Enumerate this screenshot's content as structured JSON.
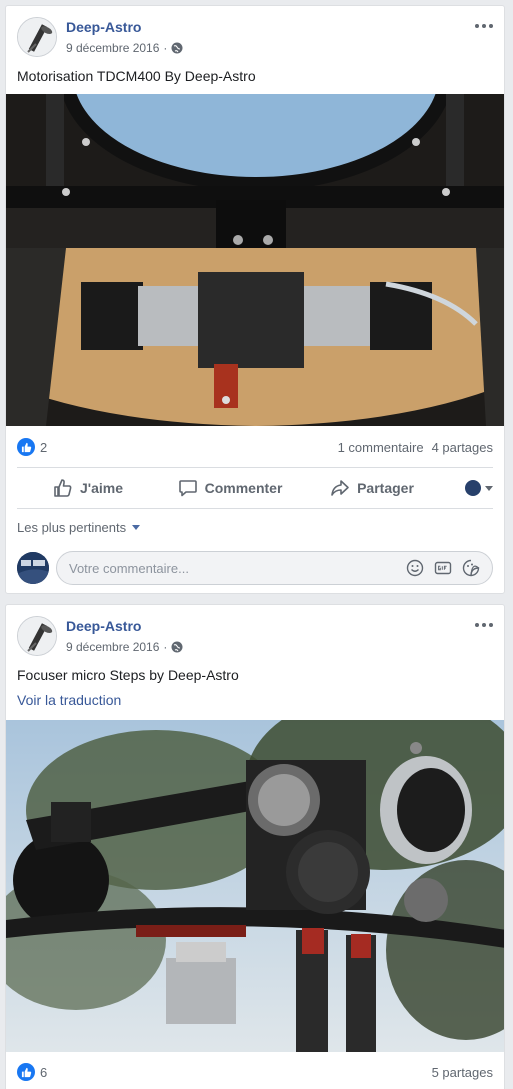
{
  "posts": [
    {
      "author": "Deep-Astro",
      "date": "9 décembre 2016",
      "caption": "Motorisation TDCM400 By Deep-Astro",
      "likes": "2",
      "comments": "1 commentaire",
      "shares": "4 partages",
      "actions": {
        "like": "J'aime",
        "comment": "Commenter",
        "share": "Partager"
      },
      "sort_label": "Les plus pertinents",
      "comment_placeholder": "Votre commentaire..."
    },
    {
      "author": "Deep-Astro",
      "date": "9 décembre 2016",
      "caption": "Focuser micro Steps by Deep-Astro",
      "translate_link": "Voir la traduction",
      "likes": "6",
      "shares": "5 partages"
    }
  ],
  "icons": {
    "globe": "globe-icon",
    "more": "more-options-icon",
    "like": "thumbs-up-icon",
    "comment": "speech-bubble-icon",
    "share": "share-arrow-icon",
    "emoji": "emoji-icon",
    "gif": "gif-icon",
    "sticker": "sticker-icon"
  },
  "colors": {
    "link": "#385898",
    "like_badge": "#1877f2",
    "muted": "#606770"
  }
}
